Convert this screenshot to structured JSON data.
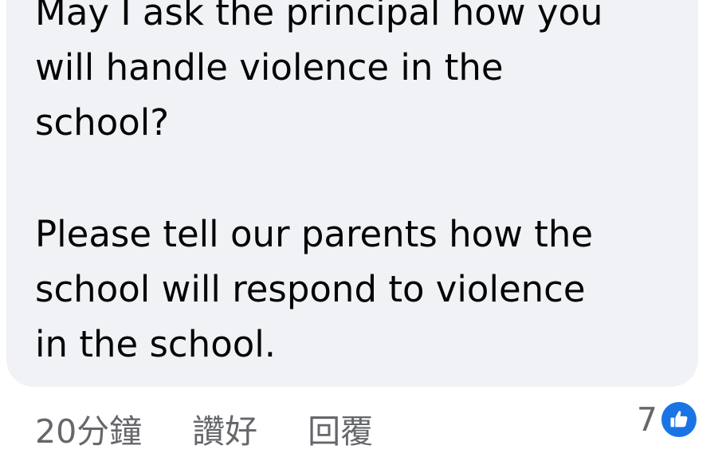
{
  "comment": {
    "paragraph1": "May I ask the principal how you\nwill handle violence in the\nschool?",
    "paragraph2": "Please tell our parents how the\nschool will respond to violence\nin the school."
  },
  "actions": {
    "time": "20分鐘",
    "like_label": "讚好",
    "reply_label": "回覆"
  },
  "reactions": {
    "count": "7",
    "icon": "thumbs-up-icon",
    "color": "#1b74e4"
  }
}
